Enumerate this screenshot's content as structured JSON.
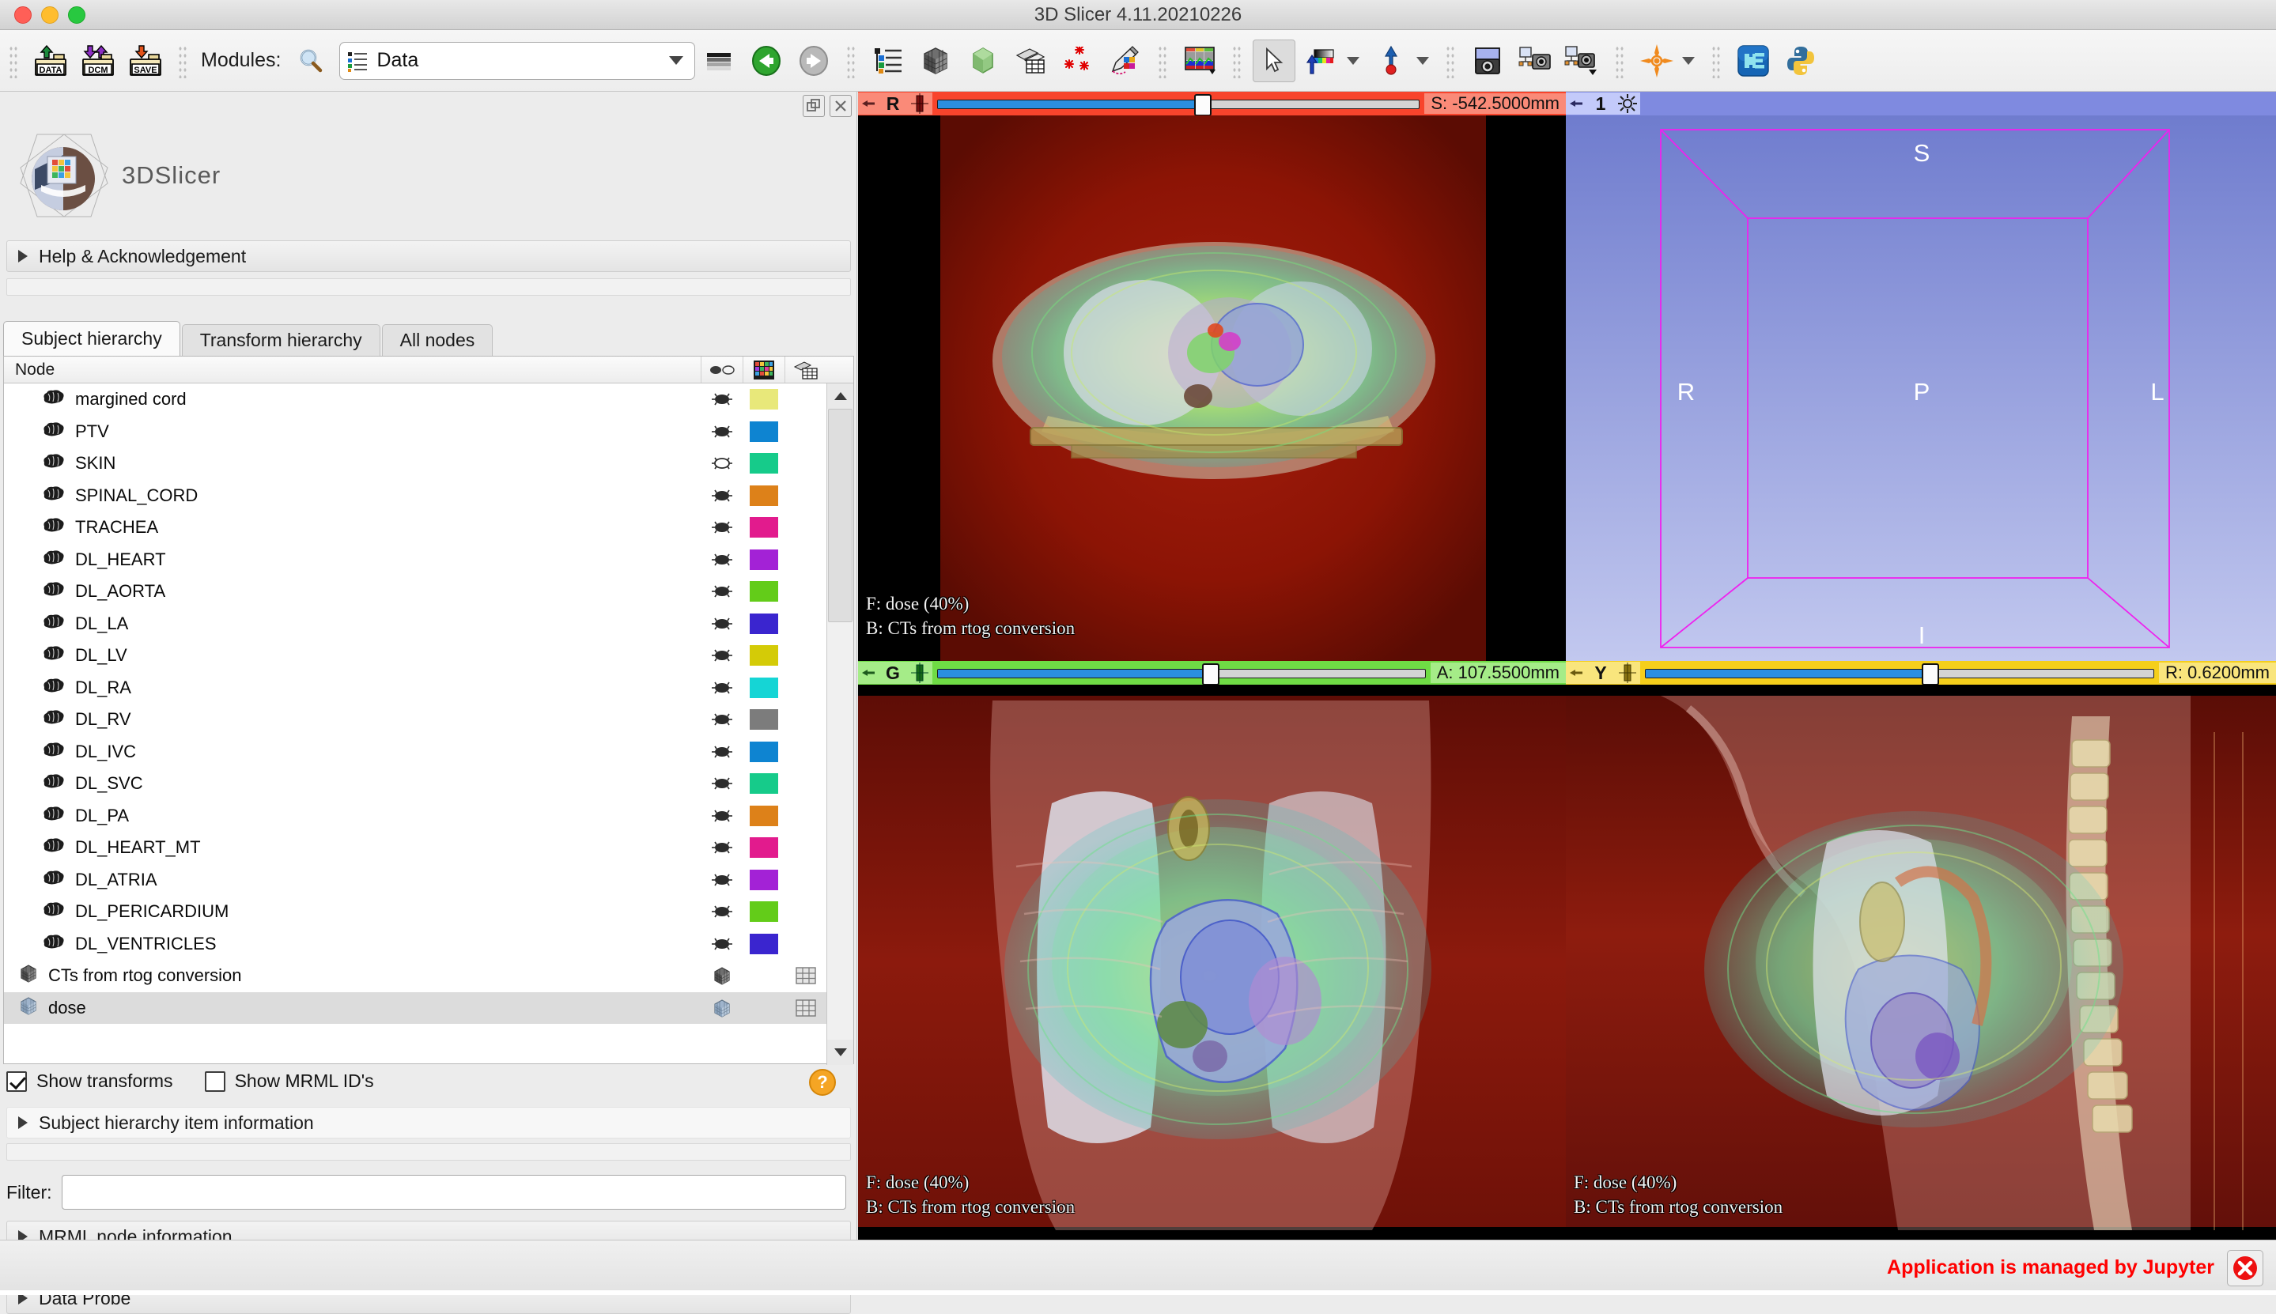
{
  "window": {
    "title": "3D Slicer 4.11.20210226"
  },
  "titlebar": {
    "close": "close",
    "minimize": "minimize",
    "zoom": "zoom"
  },
  "toolbar": {
    "load_data_label": "DATA",
    "load_dicom_label": "DCM",
    "save_label": "SAVE",
    "modules_label": "Modules:",
    "module_search_icon": "search-icon",
    "module_current": "Data",
    "items": [
      "module-history-icon",
      "previous-module-icon",
      "next-module-icon",
      "subject-hierarchy-icon",
      "volume-rendering-icon",
      "models-icon",
      "transforms-icon",
      "markups-icon",
      "segment-editor-icon",
      "layout-icon",
      "mouse-mode-icon",
      "window-level-icon",
      "crosshair-icon",
      "screenshot-icon",
      "scene-views-capture-icon",
      "capture-icon",
      "crosshair-jump-icon",
      "extension-manager-icon",
      "python-console-icon"
    ]
  },
  "panel": {
    "logo_text": "3DSlicer",
    "help_section": "Help & Acknowledgement",
    "tabs": [
      {
        "label": "Subject hierarchy",
        "active": true
      },
      {
        "label": "Transform hierarchy",
        "active": false
      },
      {
        "label": "All nodes",
        "active": false
      }
    ],
    "tree": {
      "column_node": "Node",
      "column_icons": [
        "visibility-column-icon",
        "color-column-icon",
        "transform-column-icon"
      ],
      "rows": [
        {
          "name": "margined cord",
          "type": "segmentation",
          "color": "#e8e87a",
          "visible": true,
          "indent": 1,
          "selected": false
        },
        {
          "name": "PTV",
          "type": "segmentation",
          "color": "#0e84d1",
          "visible": true,
          "indent": 1,
          "selected": false
        },
        {
          "name": "SKIN",
          "type": "segmentation",
          "color": "#16cb8a",
          "visible": false,
          "indent": 1,
          "selected": false
        },
        {
          "name": "SPINAL_CORD",
          "type": "segmentation",
          "color": "#dd8119",
          "visible": true,
          "indent": 1,
          "selected": false
        },
        {
          "name": "TRACHEA",
          "type": "segmentation",
          "color": "#e21b8d",
          "visible": true,
          "indent": 1,
          "selected": false
        },
        {
          "name": "DL_HEART",
          "type": "segmentation",
          "color": "#a322d6",
          "visible": true,
          "indent": 1,
          "selected": false
        },
        {
          "name": "DL_AORTA",
          "type": "segmentation",
          "color": "#63cc19",
          "visible": true,
          "indent": 1,
          "selected": false
        },
        {
          "name": "DL_LA",
          "type": "segmentation",
          "color": "#3a25cf",
          "visible": true,
          "indent": 1,
          "selected": false
        },
        {
          "name": "DL_LV",
          "type": "segmentation",
          "color": "#d4cb07",
          "visible": true,
          "indent": 1,
          "selected": false
        },
        {
          "name": "DL_RA",
          "type": "segmentation",
          "color": "#15d5d5",
          "visible": true,
          "indent": 1,
          "selected": false
        },
        {
          "name": "DL_RV",
          "type": "segmentation",
          "color": "#7c7c7c",
          "visible": true,
          "indent": 1,
          "selected": false
        },
        {
          "name": "DL_IVC",
          "type": "segmentation",
          "color": "#0e84d1",
          "visible": true,
          "indent": 1,
          "selected": false
        },
        {
          "name": "DL_SVC",
          "type": "segmentation",
          "color": "#16cb8a",
          "visible": true,
          "indent": 1,
          "selected": false
        },
        {
          "name": "DL_PA",
          "type": "segmentation",
          "color": "#dd8119",
          "visible": true,
          "indent": 1,
          "selected": false
        },
        {
          "name": "DL_HEART_MT",
          "type": "segmentation",
          "color": "#e21b8d",
          "visible": true,
          "indent": 1,
          "selected": false
        },
        {
          "name": "DL_ATRIA",
          "type": "segmentation",
          "color": "#a322d6",
          "visible": true,
          "indent": 1,
          "selected": false
        },
        {
          "name": "DL_PERICARDIUM",
          "type": "segmentation",
          "color": "#63cc19",
          "visible": true,
          "indent": 1,
          "selected": false
        },
        {
          "name": "DL_VENTRICLES",
          "type": "segmentation",
          "color": "#3a25cf",
          "visible": true,
          "indent": 1,
          "selected": false
        },
        {
          "name": "CTs from rtog conversion",
          "type": "volume",
          "color": null,
          "visible": true,
          "indent": 0,
          "selected": false
        },
        {
          "name": "dose",
          "type": "volume",
          "color": null,
          "visible": true,
          "indent": 0,
          "selected": true
        }
      ]
    },
    "show_transforms": {
      "label": "Show transforms",
      "checked": true
    },
    "show_mrml_ids": {
      "label": "Show MRML ID's",
      "checked": false
    },
    "item_info_section": "Subject hierarchy item information",
    "help_badge": "?",
    "filter_label": "Filter:",
    "filter_value": "",
    "filter_placeholder": "",
    "mrml_node_section": "MRML node information",
    "data_probe_section": "Data Probe"
  },
  "views": {
    "red": {
      "letter": "R",
      "offset_label": "S: -542.5000mm",
      "slider_percent": 55,
      "bar_color": "#f8442c",
      "bar_color_light": "#fa8a78",
      "foreground": "F: dose (40%)",
      "background": "B: CTs from rtog conversion"
    },
    "green": {
      "letter": "G",
      "offset_label": "A: 107.5500mm",
      "slider_percent": 56,
      "bar_color": "#6fdc45",
      "bar_color_light": "#a5ec88",
      "foreground": "F: dose (40%)",
      "background": "B: CTs from rtog conversion"
    },
    "yellow": {
      "letter": "Y",
      "offset_label": "R: 0.6200mm",
      "slider_percent": 56,
      "bar_color": "#f5cf1b",
      "bar_color_light": "#f9e57d",
      "foreground": "F: dose (40%)",
      "background": "B: CTs from rtog conversion"
    },
    "threed": {
      "label": "1",
      "bar_color": "#7f8ae0",
      "bar_color_light": "#c3cafa",
      "maximize_icon": "view-maximize-icon",
      "orientation_labels": {
        "superior": "S",
        "inferior": "I",
        "right": "R",
        "left": "L",
        "posterior": "P"
      },
      "box_color": "#ee22ee"
    }
  },
  "statusbar": {
    "jupyter_message": "Application is managed by Jupyter",
    "close_icon": "close-icon"
  }
}
